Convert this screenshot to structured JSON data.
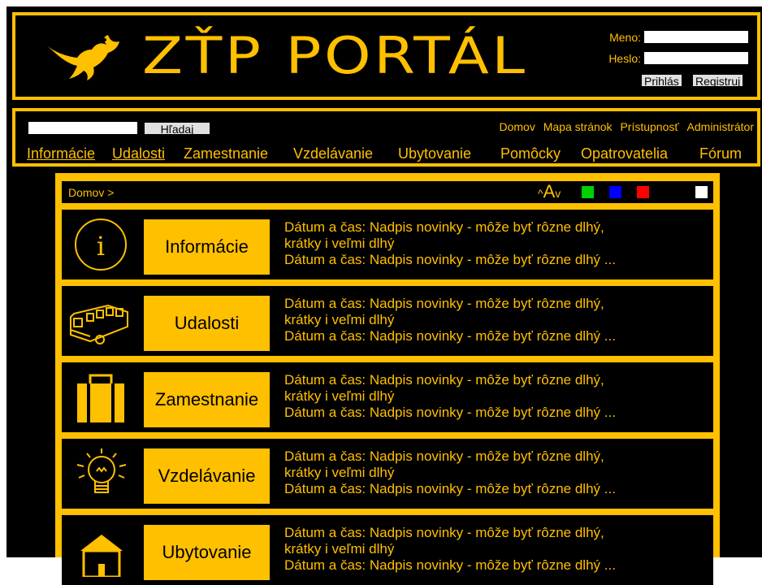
{
  "header": {
    "logo_text": "ZŤP PORTÁL",
    "login": {
      "name_label": "Meno:",
      "password_label": "Heslo:",
      "login_button": "Prihlás",
      "register_button": "Registruj"
    }
  },
  "nav": {
    "search_button": "Hľadaj",
    "top_links": [
      "Domov",
      "Mapa stránok",
      "Prístupnosť",
      "Administrátor"
    ],
    "main_links": [
      "Informácie",
      "Udalosti",
      "Zamestnanie",
      "Vzdelávanie",
      "Ubytovanie",
      "Pomôcky",
      "Opatrovatelia",
      "Fórum"
    ]
  },
  "breadcrumb": "Domov >",
  "font_control": {
    "up": "^",
    "letter": "A",
    "down": "v"
  },
  "colors": {
    "accent": "#ffc000",
    "background": "#000000",
    "swatches": [
      "#00d000",
      "#0000ff",
      "#ff0000",
      "#ffffff"
    ]
  },
  "categories": [
    {
      "label": "Informácie",
      "icon": "info-icon",
      "news": [
        "Dátum a čas: Nadpis novinky - môže byť rôzne dlhý,",
        "krátky i veľmi dlhý",
        "Dátum a čas: Nadpis novinky - môže byť rôzne dlhý ..."
      ]
    },
    {
      "label": "Udalosti",
      "icon": "bus-icon",
      "news": [
        "Dátum a čas: Nadpis novinky - môže byť rôzne dlhý,",
        "krátky i veľmi dlhý",
        "Dátum a čas: Nadpis novinky - môže byť rôzne dlhý ..."
      ]
    },
    {
      "label": "Zamestnanie",
      "icon": "suitcase-icon",
      "news": [
        "Dátum a čas: Nadpis novinky - môže byť rôzne dlhý,",
        "krátky i veľmi dlhý",
        "Dátum a čas: Nadpis novinky - môže byť rôzne dlhý ..."
      ]
    },
    {
      "label": "Vzdelávanie",
      "icon": "lightbulb-icon",
      "news": [
        "Dátum a čas: Nadpis novinky - môže byť rôzne dlhý,",
        "krátky i veľmi dlhý",
        "Dátum a čas: Nadpis novinky - môže byť rôzne dlhý ..."
      ]
    },
    {
      "label": "Ubytovanie",
      "icon": "house-icon",
      "news": [
        "Dátum a čas: Nadpis novinky - môže byť rôzne dlhý,",
        "krátky i veľmi dlhý",
        "Dátum a čas: Nadpis novinky - môže byť rôzne dlhý ..."
      ]
    }
  ]
}
